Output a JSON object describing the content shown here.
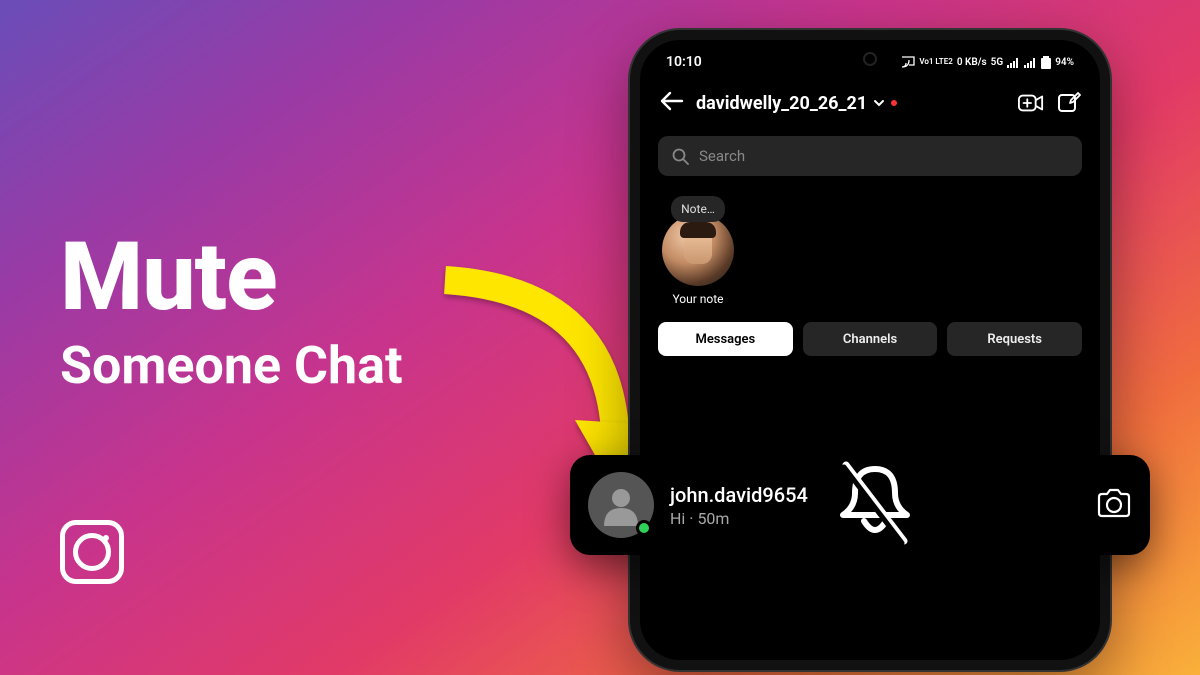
{
  "headline": {
    "line1": "Mute",
    "line2": "Someone Chat"
  },
  "status": {
    "time": "10:10",
    "battery": "94%",
    "net": "5G",
    "data": "0 KB/s",
    "lte": "Vo1 LTE2"
  },
  "header": {
    "username": "davidwelly_20_26_21"
  },
  "search": {
    "placeholder": "Search"
  },
  "note": {
    "bubble": "Note…",
    "caption": "Your note"
  },
  "tabs": {
    "messages": "Messages",
    "channels": "Channels",
    "requests": "Requests"
  },
  "chat": {
    "name": "john.david9654",
    "preview": "Hi",
    "sep": " · ",
    "time": "50m"
  }
}
